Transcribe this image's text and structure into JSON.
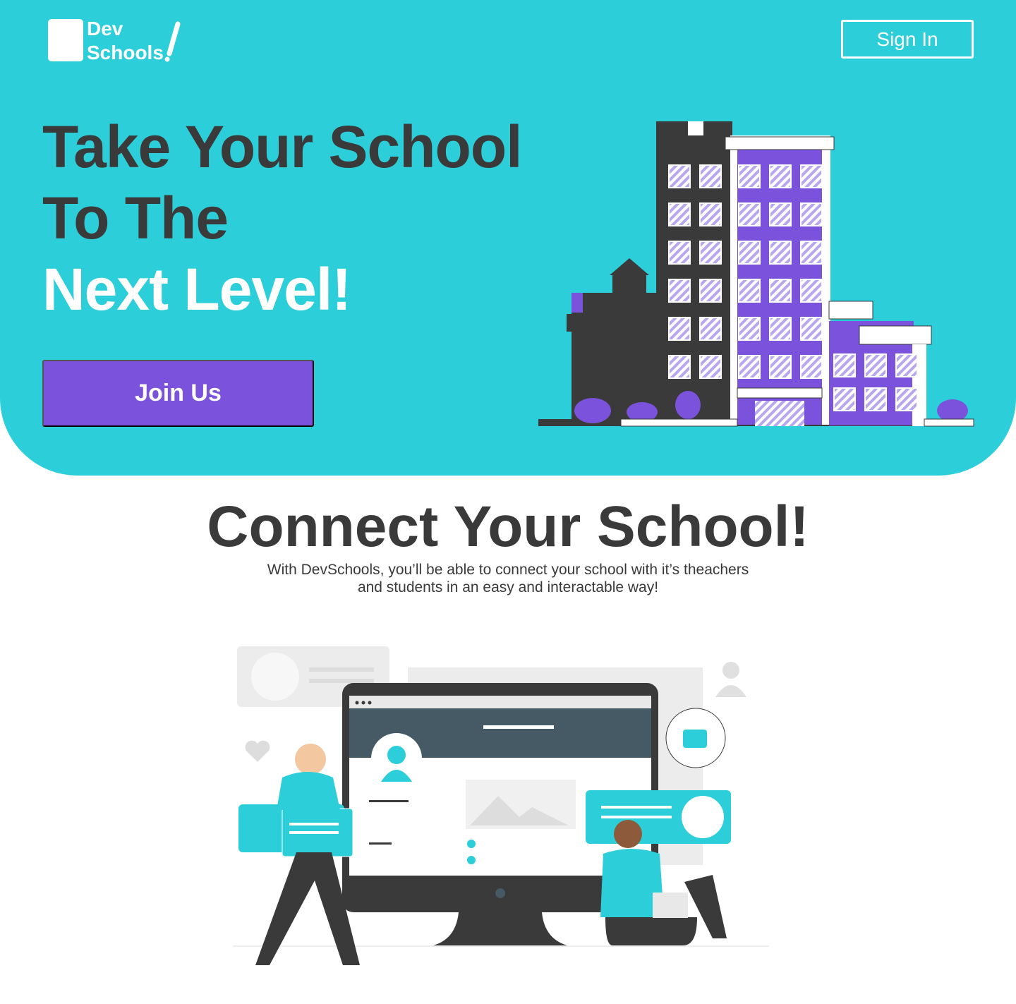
{
  "brand": {
    "line1": "Dev",
    "line2": "Schools"
  },
  "nav": {
    "signin_label": "Sign In"
  },
  "hero": {
    "line1": "Take Your School",
    "line2": "To The",
    "line3": "Next Level!",
    "cta_label": "Join Us"
  },
  "section": {
    "title": "Connect Your School!",
    "subtitle_line1": "With DevSchools, you’ll be able to connect your school with it’s theachers",
    "subtitle_line2": "and students in an easy and interactable way!"
  },
  "colors": {
    "accent": "#2ccfd9",
    "primary": "#7b52dc",
    "dark": "#3a3a3a"
  }
}
